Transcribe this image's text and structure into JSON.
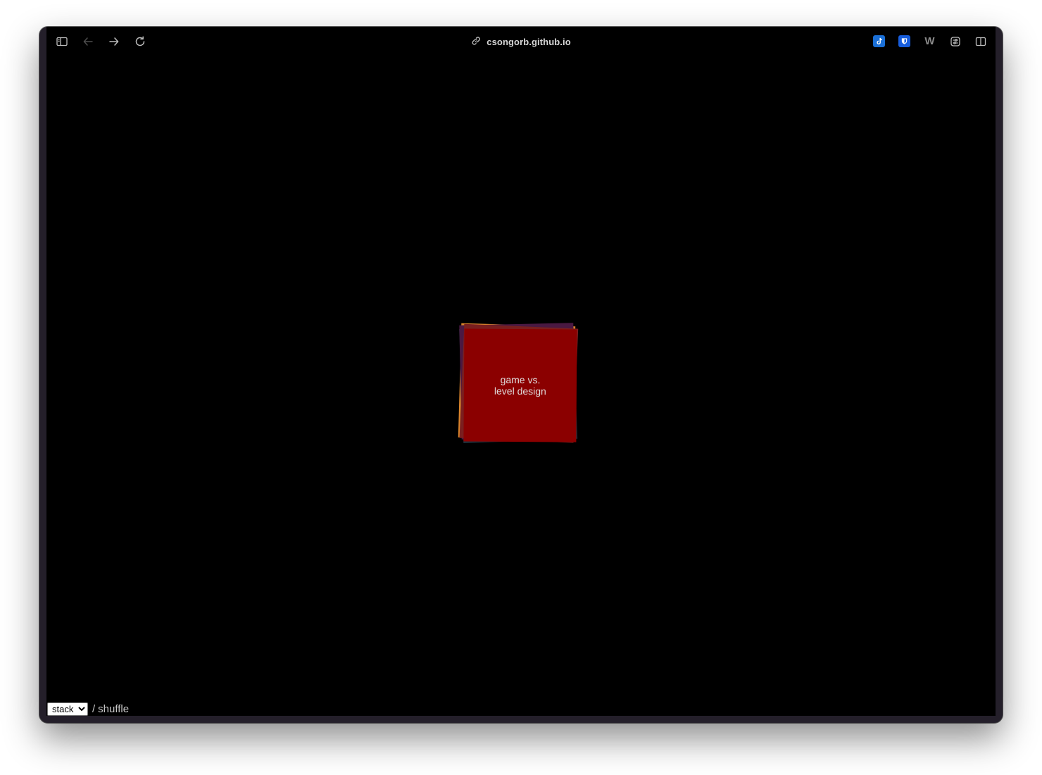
{
  "browser": {
    "address": "csongorb.github.io",
    "icons": {
      "sidebar": "sidebar-icon",
      "back": "back-arrow-icon",
      "forward": "forward-arrow-icon",
      "reload": "reload-icon",
      "address": "link-icon"
    },
    "extensions": [
      {
        "name": "tiktok-extension-icon",
        "glyph": "♪",
        "color": "#1a6fd6"
      },
      {
        "name": "bitwarden-extension-icon",
        "glyph": "",
        "color": "#175ddc"
      },
      {
        "name": "wikiwand-extension-icon",
        "glyph": "W",
        "color": "#6b6b6b"
      },
      {
        "name": "settings-extension-icon",
        "glyph": "",
        "color": "#8a8a8a"
      },
      {
        "name": "split-view-icon",
        "glyph": "",
        "color": "#bdbdbd"
      }
    ]
  },
  "cards": {
    "top_label": "game vs.\nlevel design",
    "colors": [
      "#8b0000",
      "#d8832b",
      "#1f2f3a",
      "#4a1942",
      "#7a1f1f"
    ]
  },
  "controls": {
    "mode_options": [
      "stack"
    ],
    "mode_selected": "stack",
    "separator": "/",
    "shuffle_label": "shuffle"
  }
}
